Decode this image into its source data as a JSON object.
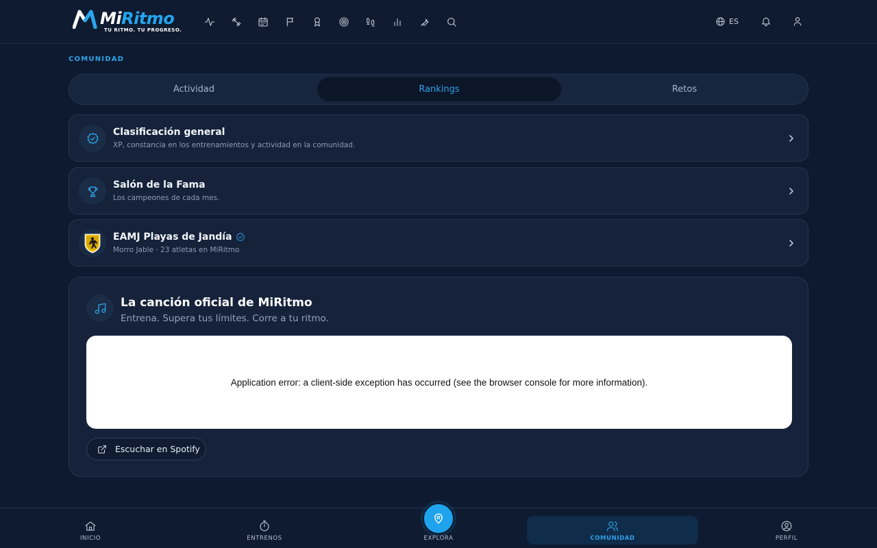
{
  "brand": {
    "name_part1": "Mi",
    "name_part2": "Ritmo",
    "tagline": "TU RITMO. TU PROGRESO."
  },
  "header": {
    "nav_icons": [
      "activity-icon",
      "dumbbell-icon",
      "calendar-icon",
      "flag-icon",
      "award-icon",
      "target-icon",
      "footprints-icon",
      "bar-chart-icon",
      "wrench-icon",
      "search-icon"
    ],
    "language": "ES"
  },
  "community": {
    "section_label": "COMUNIDAD",
    "tabs": [
      {
        "label": "Actividad",
        "active": false
      },
      {
        "label": "Rankings",
        "active": true
      },
      {
        "label": "Retos",
        "active": false
      }
    ],
    "cards": [
      {
        "title": "Clasificación general",
        "subtitle": "XP, constancia en los entrenamientos y actividad en la comunidad.",
        "icon": "badge-check-icon"
      },
      {
        "title": "Salón de la Fama",
        "subtitle": "Los campeones de cada mes.",
        "icon": "trophy-icon"
      },
      {
        "title": "EAMJ Playas de Jandía",
        "subtitle": "Morro Jable · 23 atletas en MiRitmo",
        "icon": "club-crest",
        "verified": true
      }
    ]
  },
  "song": {
    "title": "La canción oficial de MiRitmo",
    "subtitle": "Entrena. Supera tus límites. Corre a tu ritmo.",
    "player_error": "Application error: a client-side exception has occurred (see the browser console for more information).",
    "spotify_label": "Escuchar en Spotify"
  },
  "bottom_nav": {
    "items": [
      {
        "label": "INICIO",
        "icon": "home-icon"
      },
      {
        "label": "ENTRENOS",
        "icon": "stopwatch-icon"
      },
      {
        "label": "EXPLORA",
        "icon": "map-pin-icon"
      },
      {
        "label": "COMUNIDAD",
        "icon": "users-icon",
        "active": true
      },
      {
        "label": "PERFIL",
        "icon": "user-circle-icon"
      }
    ]
  },
  "colors": {
    "accent": "#2fa2e6",
    "background": "#0e1a2f",
    "card": "#15223a"
  }
}
